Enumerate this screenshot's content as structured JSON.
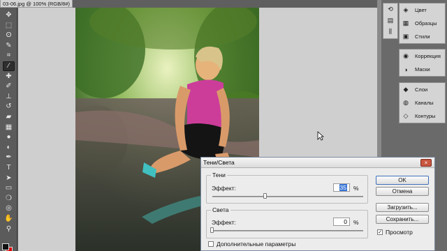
{
  "document": {
    "tab_title": "03-06.jpg @ 100% (RGB/8#)",
    "close": "×"
  },
  "tools": [
    {
      "name": "move-tool-icon",
      "glyph": "✥"
    },
    {
      "name": "marquee-tool-icon",
      "glyph": "⬚"
    },
    {
      "name": "lasso-tool-icon",
      "glyph": "ʘ"
    },
    {
      "name": "quick-selection-tool-icon",
      "glyph": "✎"
    },
    {
      "name": "crop-tool-icon",
      "glyph": "⌗"
    },
    {
      "name": "eyedropper-tool-icon",
      "glyph": "⁄",
      "active": true
    },
    {
      "name": "healing-brush-tool-icon",
      "glyph": "✚"
    },
    {
      "name": "brush-tool-icon",
      "glyph": "✐"
    },
    {
      "name": "stamp-tool-icon",
      "glyph": "⊥"
    },
    {
      "name": "history-brush-tool-icon",
      "glyph": "↺"
    },
    {
      "name": "eraser-tool-icon",
      "glyph": "▰"
    },
    {
      "name": "gradient-tool-icon",
      "glyph": "▦"
    },
    {
      "name": "blur-tool-icon",
      "glyph": "●"
    },
    {
      "name": "dodge-tool-icon",
      "glyph": "◐"
    },
    {
      "name": "pen-tool-icon",
      "glyph": "✒"
    },
    {
      "name": "type-tool-icon",
      "glyph": "T"
    },
    {
      "name": "path-selection-tool-icon",
      "glyph": "➤"
    },
    {
      "name": "shape-tool-icon",
      "glyph": "▭"
    },
    {
      "name": "3d-rotate-tool-icon",
      "glyph": "❍"
    },
    {
      "name": "3d-orbit-tool-icon",
      "glyph": "◎"
    },
    {
      "name": "hand-tool-icon",
      "glyph": "✋"
    },
    {
      "name": "zoom-tool-icon",
      "glyph": "⚲"
    }
  ],
  "panels": {
    "group1": [
      {
        "name": "color-panel",
        "icon": "color-icon",
        "glyph": "◈",
        "label": "Цвет"
      },
      {
        "name": "swatches-panel",
        "icon": "swatches-icon",
        "glyph": "▦",
        "label": "Образцы"
      },
      {
        "name": "styles-panel",
        "icon": "styles-icon",
        "glyph": "▣",
        "label": "Стили"
      }
    ],
    "group2": [
      {
        "name": "adjustments-panel",
        "icon": "adjustments-icon",
        "glyph": "◉",
        "label": "Коррекция"
      },
      {
        "name": "masks-panel",
        "icon": "masks-icon",
        "glyph": "◑",
        "label": "Маски"
      }
    ],
    "group3": [
      {
        "name": "layers-panel",
        "icon": "layers-icon",
        "glyph": "◆",
        "label": "Слои"
      },
      {
        "name": "channels-panel",
        "icon": "channels-icon",
        "glyph": "◍",
        "label": "Каналы"
      },
      {
        "name": "paths-panel",
        "icon": "paths-icon",
        "glyph": "◇",
        "label": "Контуры"
      }
    ],
    "mini_icons": [
      {
        "name": "history-panel-icon",
        "glyph": "⟲"
      },
      {
        "name": "actions-panel-icon",
        "glyph": "▤"
      },
      {
        "name": "brushes-panel-icon",
        "glyph": "⫼"
      }
    ]
  },
  "dialog": {
    "title": "Тени/Света",
    "close": "×",
    "shadows": {
      "legend": "Тени",
      "effect_label": "Эффект:",
      "value": "35",
      "unit": "%",
      "level": 0.35
    },
    "highlights": {
      "legend": "Света",
      "effect_label": "Эффект:",
      "value": "0",
      "unit": "%",
      "level": 0
    },
    "more_options": {
      "label": "Дополнительные параметры",
      "checked": false
    },
    "buttons": {
      "ok": "OK",
      "cancel": "Отмена",
      "load": "Загрузить...",
      "save": "Сохранить..."
    },
    "preview": {
      "label": "Просмотр",
      "checked": true,
      "mark": "✓"
    }
  }
}
